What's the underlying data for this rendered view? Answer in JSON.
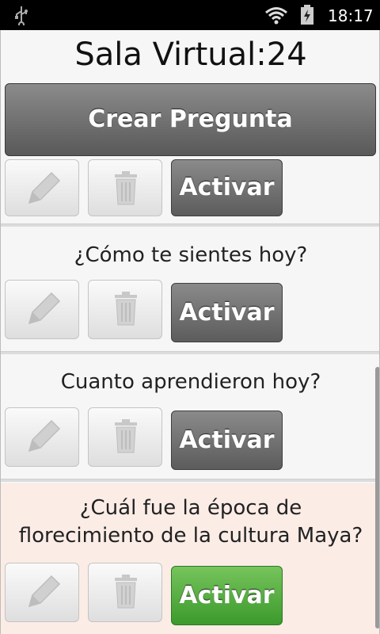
{
  "status_bar": {
    "time": "18:17",
    "icons": [
      "usb-icon",
      "wifi-icon",
      "battery-charging-icon"
    ]
  },
  "header": {
    "title": "Sala Virtual:24"
  },
  "create_button": {
    "label": "Crear Pregunta"
  },
  "questions": [
    {
      "text": "",
      "activate_label": "Activar",
      "active": false
    },
    {
      "text": "¿Cómo te sientes hoy?",
      "activate_label": "Activar",
      "active": false
    },
    {
      "text": "Cuanto aprendieron hoy?",
      "activate_label": "Activar",
      "active": false
    },
    {
      "text_line1": "¿Cuál fue la época de",
      "text_line2": "florecimiento de la cultura Maya?",
      "activate_label": "Activar",
      "active": true
    }
  ],
  "colors": {
    "activate_default": "#6b6b6b",
    "activate_active": "#4fae3a",
    "highlight_row": "#fbece6"
  }
}
